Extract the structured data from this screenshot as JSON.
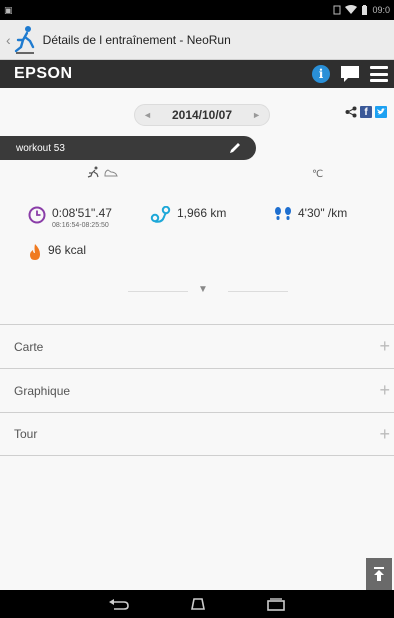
{
  "status": {
    "left": "▣",
    "time": "09:0"
  },
  "app": {
    "title": "Détails de l entraînement - NeoRun"
  },
  "brand": {
    "name": "EPSON",
    "info": "i"
  },
  "date_selector": {
    "prev": "◄",
    "date": "2014/10/07",
    "next": "►"
  },
  "share": {
    "facebook": "f"
  },
  "workout": {
    "name": "workout 53"
  },
  "temperature": {
    "unit": "℃"
  },
  "stats": {
    "duration": "0:08'51\".47",
    "time_range": "08:16:54-08:25:50",
    "distance": "1,966 km",
    "pace": "4'30\" /km",
    "calories": "96 kcal"
  },
  "sections": [
    {
      "label": "Carte"
    },
    {
      "label": "Graphique"
    },
    {
      "label": "Tour"
    }
  ],
  "colors": {
    "brand_bar": "#2f2f2f",
    "info_blue": "#2a90d8",
    "time_purple": "#8a3da8",
    "distance_cyan": "#1ea8d8",
    "pace_blue": "#1e6fd0",
    "calorie_orange": "#f07a20"
  },
  "icons": {
    "app": "runner-logo-icon",
    "share": "share-icon",
    "edit": "pencil-icon",
    "time": "clock-icon",
    "distance": "route-icon",
    "pace": "footprints-icon",
    "calories": "flame-icon",
    "scroll_top": "arrow-to-top-icon"
  }
}
